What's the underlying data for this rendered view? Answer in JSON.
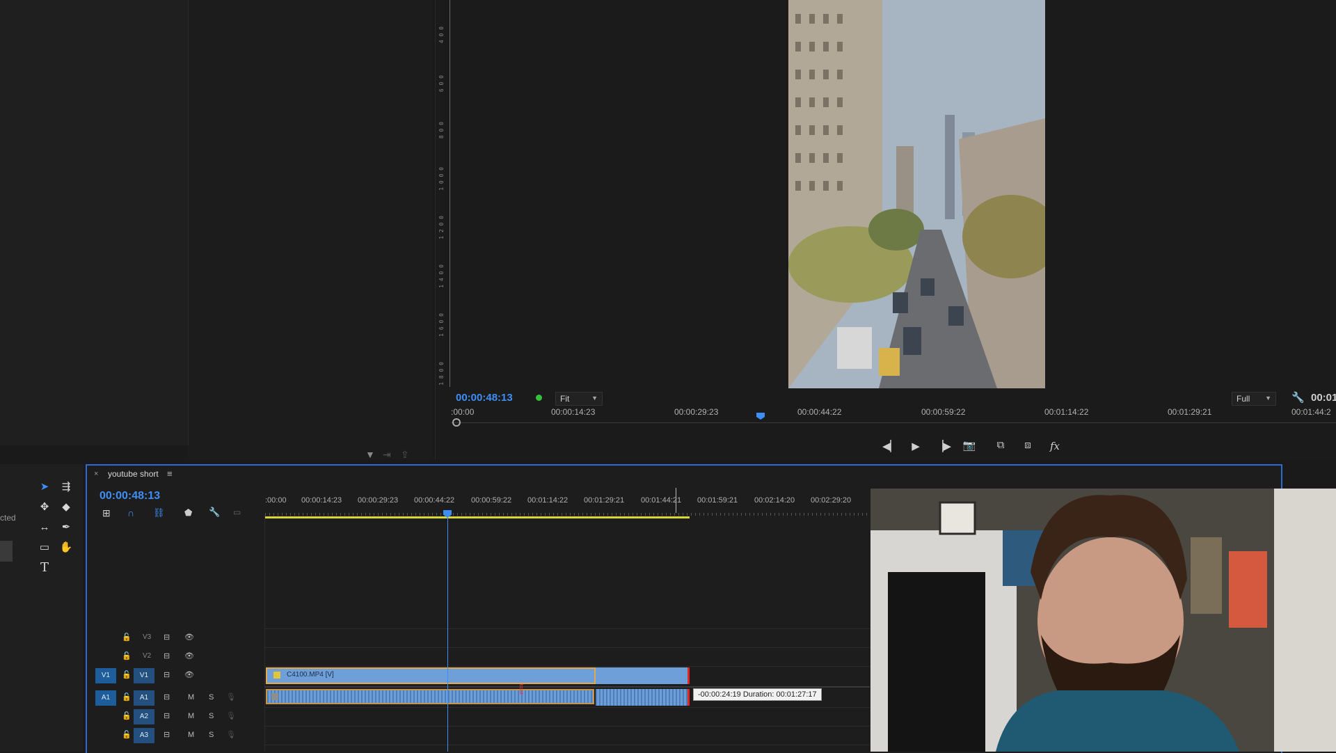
{
  "monitor": {
    "timecode": "00:00:48:13",
    "fit_label": "Fit",
    "full_label": "Full",
    "right_timecode": "00:01",
    "ruler_ticks": [
      ":00:00",
      "00:00:14:23",
      "00:00:29:23",
      "00:00:44:22",
      "00:00:59:22",
      "00:01:14:22",
      "00:01:29:21",
      "00:01:44:2"
    ],
    "vertical_ruler_labels": [
      "4 0 0",
      "6 0 0",
      "8 0 0",
      "1 0 0 0",
      "1 2 0 0",
      "1 4 0 0",
      "1 6 0 0",
      "1 8 0 0"
    ],
    "playhead_fraction": 0.35
  },
  "left_panel": {
    "cut_text": "cted"
  },
  "timeline": {
    "tab_title": "youtube short",
    "timecode": "00:00:48:13",
    "ruler_ticks": [
      ":00:00",
      "00:00:14:23",
      "00:00:29:23",
      "00:00:44:22",
      "00:00:59:22",
      "00:01:14:22",
      "00:01:29:21",
      "00:01:44:21",
      "00:01:59:21",
      "00:02:14:20",
      "00:02:29:20"
    ],
    "tracks": {
      "v3": "V3",
      "v2": "V2",
      "v1": "V1",
      "a1": "A1",
      "a2": "A2",
      "a3": "A3",
      "v1_source": "V1",
      "a1_source": "A1"
    },
    "mute_label": "M",
    "solo_label": "S",
    "clip_name": "C4100.MP4 [V]",
    "tooltip": "-00:00:24:19 Duration: 00:01:27:17"
  },
  "colors": {
    "accent_blue": "#3e8ef7",
    "clip_blue": "#6f9fd8",
    "work_area_yellow": "#d8d830",
    "trim_red": "#e02a2a"
  }
}
